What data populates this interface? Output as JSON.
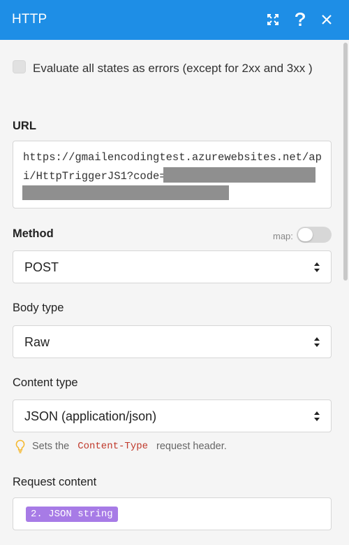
{
  "window": {
    "title": "HTTP",
    "icons": [
      "expand-icon",
      "help-icon",
      "close-icon"
    ]
  },
  "evaluate_errors": {
    "label": "Evaluate all states as errors (except for 2xx and 3xx )",
    "checked": false
  },
  "url": {
    "label": "URL",
    "value": "https://gmailencodingtest.azurewebsites.net/api/HttpTriggerJS1?code="
  },
  "method": {
    "label": "Method",
    "map_label": "map:",
    "map_toggle": false,
    "value": "POST"
  },
  "body_type": {
    "label": "Body type",
    "value": "Raw"
  },
  "content_type": {
    "label": "Content type",
    "value": "JSON (application/json)",
    "hint_prefix": "Sets the",
    "hint_code": "Content-Type",
    "hint_suffix": "request header."
  },
  "request_content": {
    "label": "Request content",
    "pill": "2. JSON string"
  },
  "colors": {
    "header": "#1e8ee6",
    "pill": "#a77be6",
    "code": "#c0392b",
    "hint_bulb": "#f5b82e"
  }
}
